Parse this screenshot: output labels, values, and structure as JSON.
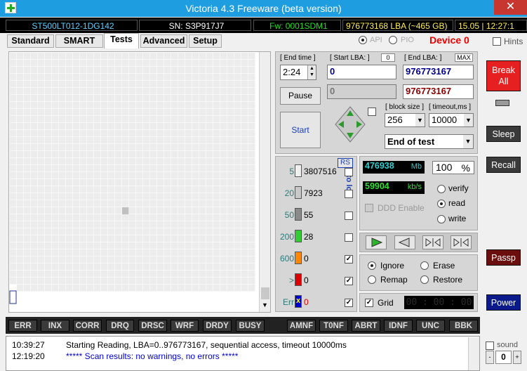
{
  "window": {
    "title": "Victoria 4.3 Freeware (beta version)",
    "close": "✕"
  },
  "info": {
    "model": "ST500LT012-1DG142",
    "serial": "SN: S3P917J7",
    "firmware": "Fw: 0001SDM1",
    "capacity": "976773168 LBA (~465 GB)",
    "clock": "15.05 | 12:27:1"
  },
  "tabs": [
    "Standard",
    "SMART",
    "Tests",
    "Advanced",
    "Setup"
  ],
  "mode": {
    "api": "API",
    "pio": "PIO",
    "device": "Device 0",
    "hints": "Hints"
  },
  "range": {
    "end_time_label": "[ End time ]",
    "end_time": "2:24",
    "start_lba_label": "[ Start LBA: ]",
    "start_lba_badge": "0",
    "start_lba": "0",
    "end_lba_label": "[ End LBA: ]",
    "max_badge": "MAX",
    "end_lba": "976773167",
    "current_lba": "0",
    "end_lba2": "976773167"
  },
  "buttons": {
    "pause": "Pause",
    "start": "Start",
    "break": "Break\nAll",
    "sleep": "Sleep",
    "recall": "Recall",
    "passp": "Passp",
    "power": "Power",
    "rs": "RS"
  },
  "block": {
    "size_label": "[ block size ]",
    "size": "256",
    "timeout_label": "[ timeout,ms ]",
    "timeout": "10000",
    "end_action": "End of test"
  },
  "stats": {
    "mb": "476938",
    "mb_unit": "Mb",
    "percent": "100",
    "percent_unit": "%",
    "speed": "59904",
    "speed_unit": "kb/s",
    "ddd": "DDD Enable",
    "to_log": "to log:"
  },
  "timing": [
    {
      "label": "5",
      "count": "3807516",
      "color": "#f0f0f0",
      "log": false
    },
    {
      "label": "20",
      "count": "7923",
      "color": "#c8c8c8",
      "log": false
    },
    {
      "label": "50",
      "count": "55",
      "color": "#8a8a8a",
      "log": false
    },
    {
      "label": "200",
      "count": "28",
      "color": "#33cc33",
      "log": false
    },
    {
      "label": "600",
      "count": "0",
      "color": "#ff8800",
      "log": true
    },
    {
      "label": ">",
      "count": "0",
      "color": "#dd0000",
      "log": true
    },
    {
      "label": "Err",
      "count": "0",
      "color": "#0000cc",
      "log": true
    }
  ],
  "test_mode": {
    "verify": "verify",
    "read": "read",
    "write": "write",
    "selected": "read"
  },
  "repair": {
    "ignore": "Ignore",
    "erase": "Erase",
    "remap": "Remap",
    "restore": "Restore",
    "selected": "Ignore"
  },
  "grid_opt": {
    "label": "Grid",
    "timer": "00 : 00 : 00"
  },
  "flags": [
    "ERR",
    "INX",
    "CORR",
    "DRQ",
    "DRSC",
    "WRF",
    "DRDY",
    "BUSY",
    "AMNF",
    "T0NF",
    "ABRT",
    "IDNF",
    "UNC",
    "BBK"
  ],
  "log": [
    {
      "time": "10:39:27",
      "text": "Starting Reading, LBA=0..976773167, sequential access, timeout 10000ms",
      "color": "#000000"
    },
    {
      "time": "12:19:20",
      "text": "***** Scan results: no warnings, no errors *****",
      "color": "#0000cc"
    }
  ],
  "sound": {
    "label": "sound",
    "value": "0"
  }
}
